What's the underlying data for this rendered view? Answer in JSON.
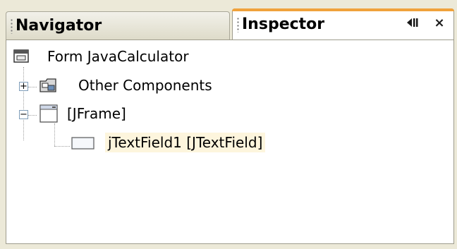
{
  "tabs": [
    {
      "label": "Navigator",
      "active": false
    },
    {
      "label": "Inspector",
      "active": true
    }
  ],
  "tab_tools": {
    "minimize_icon": "minimize-panel-icon",
    "close_glyph": "×"
  },
  "tree": {
    "root": {
      "label": "Form JavaCalculator",
      "icon": "form-icon"
    },
    "other_components": {
      "label": "Other Components",
      "icon": "components-folder-icon",
      "expanded": false
    },
    "jframe": {
      "label": "[JFrame]",
      "icon": "frame-icon",
      "expanded": true
    },
    "jtextfield": {
      "label": "jTextField1 [JTextField]",
      "icon": "textfield-icon",
      "selected": true
    }
  },
  "colors": {
    "active_tab_accent": "#f0a23c",
    "selection_background": "#fdf5dd",
    "window_background": "#ece9d8"
  }
}
